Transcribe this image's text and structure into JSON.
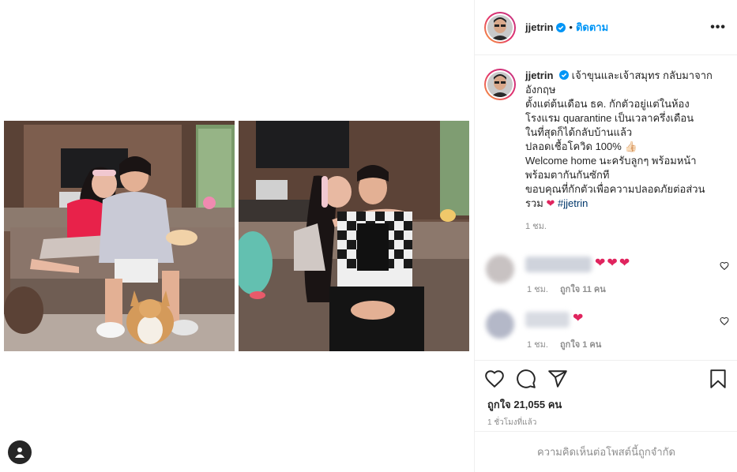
{
  "post": {
    "username": "jjetrin",
    "separator": "•",
    "follow_label": "ติดตาม",
    "more_label": "•••",
    "caption_lines": [
      "เจ้าขุนและเจ้าสมุทร กลับมาจาก",
      "อังกฤษ",
      "ตั้งแต่ต้นเดือน ธค. กักตัวอยู่แต่ในห้อง",
      "โรงแรม quarantine เป็นเวลาครึ่งเดือน",
      "ในที่สุดก็ได้กลับบ้านแล้ว",
      "ปลอดเชื้อโควิด 100%",
      "Welcome home นะครับลูกๆ พร้อมหน้า",
      "พร้อมตากันกันซักที",
      "ขอบคุณที่กักตัวเพื่อความปลอดภัยต่อส่วน",
      "รวม"
    ],
    "thumb_emoji": "👍🏻",
    "heart_emoji": "❤",
    "hashtag": "#jjetrin",
    "caption_time": "1 ชม.",
    "likes": "ถูกใจ 21,055 คน",
    "post_time": "1 ชั่วโมงที่แล้ว",
    "comments_disabled": "ความคิดเห็นต่อโพสต์นี้ถูกจำกัด"
  },
  "comments": [
    {
      "hearts": "❤❤❤",
      "time": "1 ชม.",
      "likes": "ถูกใจ 11 คน"
    },
    {
      "hearts": "❤",
      "time": "1 ชม.",
      "likes": "ถูกใจ 1 คน"
    }
  ],
  "icons": {
    "verified": "verified-badge-icon",
    "like": "heart-outline-icon",
    "comment": "speech-bubble-icon",
    "share": "paper-plane-icon",
    "save": "bookmark-icon",
    "comment_like": "small-heart-icon",
    "profile": "user-icon"
  },
  "colors": {
    "accent": "#0095f6",
    "text": "#262626",
    "muted": "#8e8e8e",
    "heart": "#e0245e",
    "hashtag": "#00376b",
    "border": "#efefef"
  }
}
